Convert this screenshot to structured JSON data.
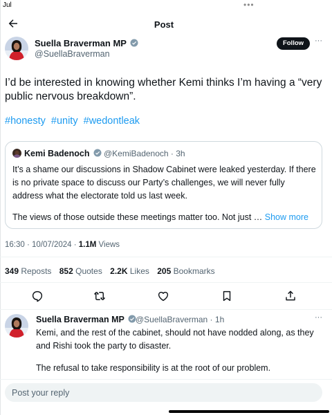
{
  "status_bar": {
    "time": "Jul",
    "dots": "•••"
  },
  "header": {
    "title": "Post"
  },
  "post": {
    "author_name": "Suella Braverman MP",
    "author_handle": "@SuellaBraverman",
    "follow_label": "Follow",
    "more_label": "···",
    "text": "I’d be interested in knowing whether Kemi thinks I’m having a “very public nervous breakdown”.",
    "hashtags": [
      "#honesty",
      "#unity",
      "#wedontleak"
    ]
  },
  "quote": {
    "author_name": "Kemi Badenoch",
    "author_handle": "@KemiBadenoch · 3h",
    "text_p1": "It’s a shame our discussions in Shadow Cabinet were leaked yesterday. If there is no private space to discuss our Party’s challenges, we will never fully address what the electorate told us last week.",
    "text_p2": "The views of those outside these meetings matter too. Not just … ",
    "show_more": "Show more"
  },
  "meta": {
    "timestamp": "16:30 · 10/07/2024 · ",
    "views_count": "1.1M",
    "views_label": " Views"
  },
  "stats": {
    "reposts_count": "349",
    "reposts_label": "Reposts",
    "quotes_count": "852",
    "quotes_label": "Quotes",
    "likes_count": "2.2K",
    "likes_label": "Likes",
    "bookmarks_count": "205",
    "bookmarks_label": "Bookmarks"
  },
  "actions": [
    "reply-icon",
    "repost-icon",
    "like-icon",
    "bookmark-icon",
    "share-icon"
  ],
  "reply": {
    "author_name": "Suella Braverman MP",
    "author_handle": "@SuellaBraverman · 1h",
    "more_label": "···",
    "text_p1": "Kemi, and the rest of the cabinet, should not have nodded along, as they and Rishi took the party to disaster.",
    "text_p2": "The refusal to take responsibility is at the root of our problem."
  },
  "compose": {
    "placeholder": "Post your reply"
  },
  "colors": {
    "accent": "#1d9bf0",
    "text": "#0f1419",
    "secondary": "#536471",
    "border": "#cfd9de"
  }
}
